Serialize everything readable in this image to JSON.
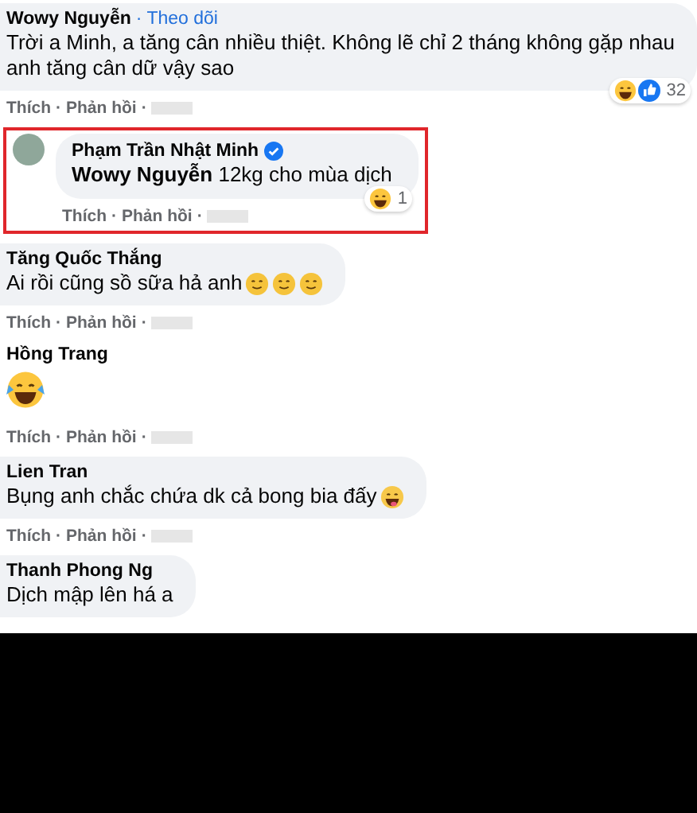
{
  "separator": "·",
  "comments": [
    {
      "kind": "bubble",
      "author": "Wowy Nguyễn",
      "follow": "Theo dõi",
      "text": "Trời a Minh, a tăng cân nhiều thiệt. Không lẽ chỉ 2 tháng không gặp nhau anh tăng cân dữ vậy sao",
      "reactions": [
        {
          "kind": "haha"
        },
        {
          "kind": "like"
        }
      ],
      "reaction_count": "32",
      "actions": [
        "Thích",
        "Phản hồi"
      ],
      "timestamp_blurred": true
    },
    {
      "kind": "reply",
      "author": "Phạm Trần Nhật Minh",
      "text": "**Wowy Nguyễn** 12kg cho mùa dịch",
      "reactions": [
        {
          "kind": "haha"
        }
      ],
      "reaction_count": "1",
      "actions": [
        "Thích",
        "Phản hồi"
      ],
      "timestamp_blurred": true,
      "highlighted": true,
      "verified": true
    },
    {
      "kind": "bubble",
      "author": "Tăng Quốc Thắng",
      "text": "Ai rồi cũng sồ sữa hả anh",
      "emojis": [
        {
          "kind": "smirk"
        },
        {
          "kind": "smirk"
        },
        {
          "kind": "smirk"
        }
      ],
      "actions": [
        "Thích",
        "Phản hồi"
      ],
      "timestamp_blurred": true
    },
    {
      "kind": "sticker",
      "author": "Hồng Trang",
      "emojis": [
        {
          "kind": "laugh"
        }
      ],
      "actions": [
        "Thích",
        "Phản hồi"
      ],
      "timestamp_blurred": true
    },
    {
      "kind": "bubble",
      "author": "Lien Tran",
      "text": "Bụng anh chắc chứa dk cả bong bia đấy",
      "emojis": [
        {
          "kind": "tongue"
        }
      ],
      "actions": [
        "Thích",
        "Phản hồi"
      ],
      "timestamp_blurred": true
    },
    {
      "kind": "bubble",
      "author": "Thanh Phong Ng",
      "text": "Dịch mập lên há a"
    }
  ]
}
